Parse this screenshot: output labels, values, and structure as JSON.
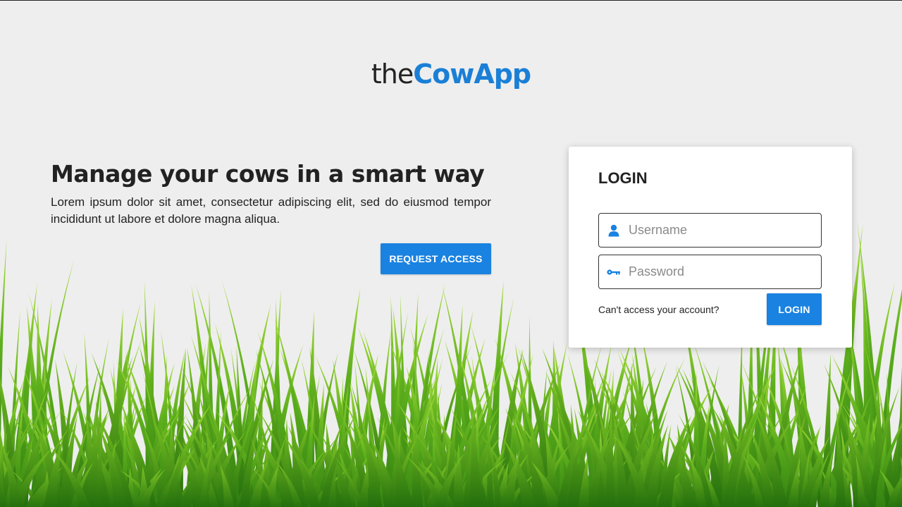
{
  "logo": {
    "prefix": "the",
    "brand": "CowApp"
  },
  "hero": {
    "heading": "Manage your cows in a smart way",
    "body": "Lorem ipsum dolor sit amet, consectetur adipiscing elit, sed do eiusmod tempor incididunt ut labore et dolore magna aliqua.",
    "request_button": "REQUEST ACCESS"
  },
  "login": {
    "title": "LOGIN",
    "username_placeholder": "Username",
    "password_placeholder": "Password",
    "help_link": "Can't access your account?",
    "submit_button": "LOGIN"
  },
  "theme": {
    "accent": "#1a82e0",
    "brand_blue": "#1a7fd6",
    "background": "#eeeeee",
    "grass_dark": "#2f7d10",
    "grass_light": "#8fd12a"
  },
  "icons": {
    "username": "user-icon",
    "password": "key-icon"
  }
}
